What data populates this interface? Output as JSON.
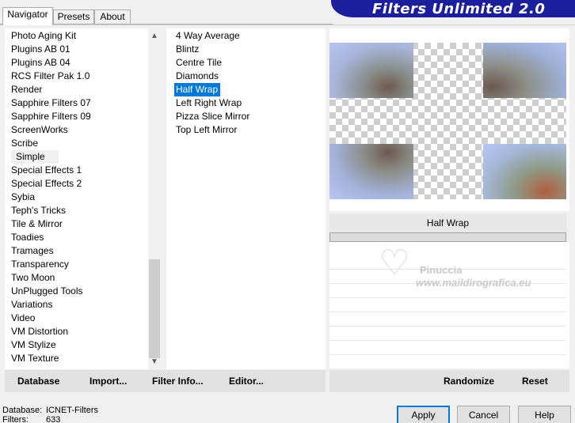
{
  "tabs": [
    {
      "label": "Navigator",
      "active": true
    },
    {
      "label": "Presets",
      "active": false
    },
    {
      "label": "About",
      "active": false
    }
  ],
  "brand": {
    "title": "Filters Unlimited 2.0",
    "color": "#1c1f9b"
  },
  "categories": [
    "Photo Aging Kit",
    "Plugins AB 01",
    "Plugins AB 04",
    "RCS Filter Pak 1.0",
    "Render",
    "Sapphire Filters 07",
    "Sapphire Filters 09",
    "ScreenWorks",
    "Scribe",
    "Simple",
    "Special Effects 1",
    "Special Effects 2",
    "Sybia",
    "Teph's Tricks",
    "Tile & Mirror",
    "Toadies",
    "Tramages",
    "Transparency",
    "Two Moon",
    "UnPlugged Tools",
    "Variations",
    "Video",
    "VM Distortion",
    "VM Stylize",
    "VM Texture"
  ],
  "selected_category": "Simple",
  "filters": [
    "4 Way Average",
    "Blintz",
    "Centre Tile",
    "Diamonds",
    "Half Wrap",
    "Left Right Wrap",
    "Pizza Slice Mirror",
    "Top Left Mirror"
  ],
  "selected_filter": "Half Wrap",
  "preview": {
    "filter_name": "Half Wrap"
  },
  "watermark": {
    "name": "Pinuccia",
    "url": "www.maildirografica.eu"
  },
  "bottom_bar": {
    "database": "Database",
    "import": "Import...",
    "filter_info": "Filter Info...",
    "editor": "Editor...",
    "randomize": "Randomize",
    "reset": "Reset"
  },
  "status": {
    "database_label": "Database:",
    "database_value": "ICNET-Filters",
    "filters_label": "Filters:",
    "filters_value": "633"
  },
  "buttons": {
    "apply": "Apply",
    "cancel": "Cancel",
    "help": "Help"
  },
  "accent_color": "#0078d7"
}
